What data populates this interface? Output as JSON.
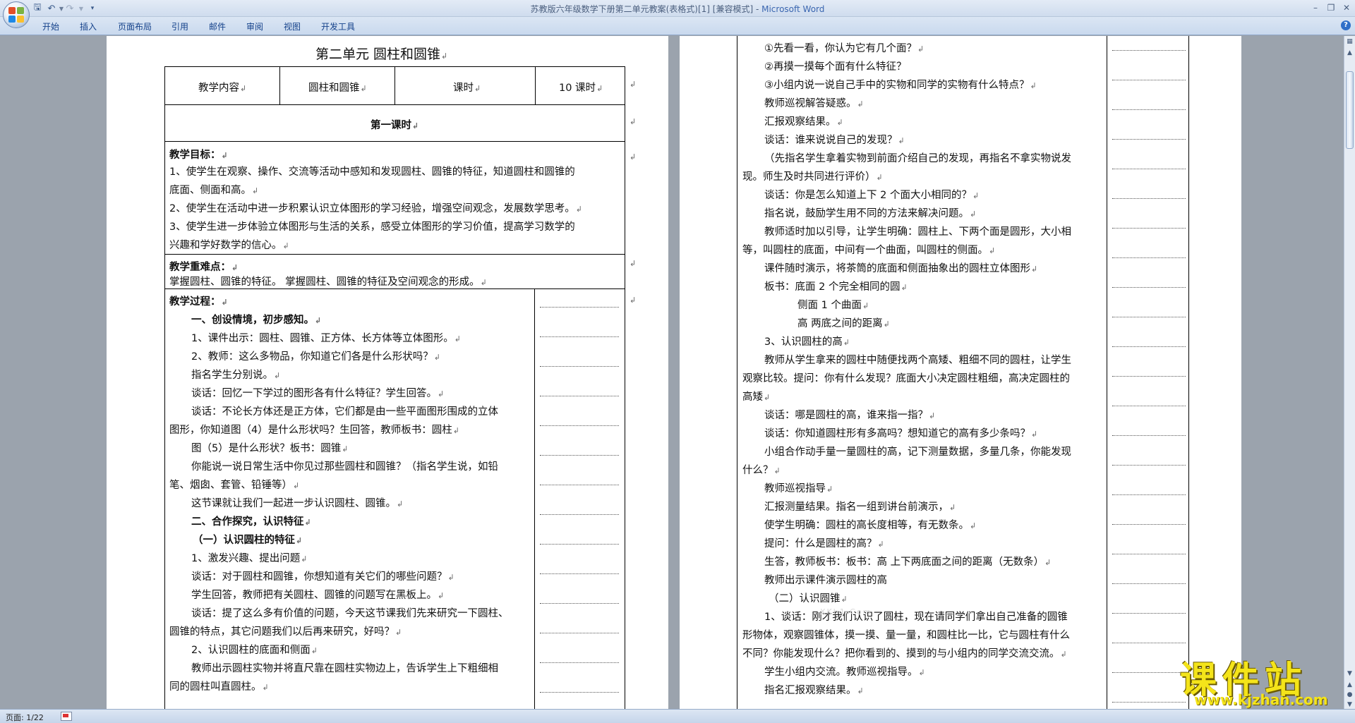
{
  "title_bar": {
    "doc_title": "苏教版六年级数学下册第二单元教案(表格式)[1] [兼容模式]",
    "separator": " - ",
    "app_name": "Microsoft Word",
    "qat_icons": [
      "save-icon",
      "undo-icon",
      "redo-icon",
      "customize-icon"
    ],
    "window_buttons": [
      "minimize",
      "restore",
      "close"
    ]
  },
  "ribbon": {
    "tabs": [
      "开始",
      "插入",
      "页面布局",
      "引用",
      "邮件",
      "审阅",
      "视图",
      "开发工具"
    ]
  },
  "page1": {
    "heading": "第二单元    圆柱和圆锥",
    "row1": [
      "教学内容",
      "圆柱和圆锥",
      "课时",
      "10 课时"
    ],
    "lesson": "第一课时",
    "goals": [
      "教学目标：",
      "1、使学生在观察、操作、交流等活动中感知和发现圆柱、圆锥的特征，知道圆柱和圆锥的",
      "底面、侧面和高。",
      "2、使学生在活动中进一步积累认识立体图形的学习经验，增强空间观念，发展数学思考。",
      "3、使学生进一步体验立体图形与生活的关系，感受立体图形的学习价值，提高学习数学的",
      "兴趣和学好数学的信心。"
    ],
    "key_points": [
      "教学重难点：",
      "掌握圆柱、圆锥的特征。   掌握圆柱、圆锥的特征及空间观念的形成。"
    ],
    "process": [
      "教学过程：",
      "一、创设情境，初步感知。",
      "1、课件出示：圆柱、圆锥、正方体、长方体等立体图形。",
      "2、教师：这么多物品，你知道它们各是什么形状吗？",
      "指名学生分别说。",
      "谈话：回忆一下学过的图形各有什么特征？学生回答。",
      "谈话：不论长方体还是正方体，它们都是由一些平面图形围成的立体",
      "图形，你知道图（4）是什么形状吗？生回答，教师板书：圆柱",
      "图（5）是什么形状？板书：圆锥",
      "你能说一说日常生活中你见过那些圆柱和圆锥？（指名学生说，如铅",
      "笔、烟囱、套管、铅锤等）",
      "这节课就让我们一起进一步认识圆柱、圆锥。",
      "二、合作探究，认识特征",
      "（一）认识圆柱的特征",
      "1、激发兴趣、提出问题",
      "谈话：对于圆柱和圆锥，你想知道有关它们的哪些问题？",
      "学生回答，教师把有关圆柱、圆锥的问题写在黑板上。",
      "谈话：提了这么多有价值的问题，今天这节课我们先来研究一下圆柱、",
      "圆锥的特点，其它问题我们以后再来研究，好吗？",
      "2、认识圆柱的底面和侧面",
      "教师出示圆柱实物并将直尺靠在圆柱实物边上，告诉学生上下粗细相",
      "同的圆柱叫直圆柱。"
    ]
  },
  "page2": {
    "lines": [
      "①先看一看，你认为它有几个面？",
      "②再摸一摸每个面有什么特征？",
      "③小组内说一说自己手中的实物和同学的实物有什么特点？",
      "教师巡视解答疑惑。",
      "汇报观察结果。",
      "谈话：谁来说说自己的发现？",
      "（先指名学生拿着实物到前面介绍自己的发现，再指名不拿实物说发",
      "现。师生及时共同进行评价）",
      "谈话：你是怎么知道上下 2 个面大小相同的？",
      "指名说，鼓励学生用不同的方法来解决问题。",
      "教师适时加以引导，让学生明确：圆柱上、下两个面是圆形，大小相",
      "等，叫圆柱的底面，中间有一个曲面，叫圆柱的侧面。",
      "课件随时演示，将茶筒的底面和侧面抽象出的圆柱立体图形",
      "板书：底面       2 个完全相同的圆",
      "侧面      1 个曲面",
      "高      两底之间的距离",
      "3、认识圆柱的高",
      "教师从学生拿来的圆柱中随便找两个高矮、粗细不同的圆柱，让学生",
      "观察比较。提问：你有什么发现？底面大小决定圆柱粗细，高决定圆柱的",
      "高矮",
      "谈话：哪是圆柱的高，谁来指一指？",
      "谈话：你知道圆柱形有多高吗？想知道它的高有多少条吗？",
      "小组合作动手量一量圆柱的高，记下测量数据，多量几条，你能发现",
      "什么？",
      "教师巡视指导",
      "汇报测量结果。指名一组到讲台前演示，",
      "使学生明确：圆柱的高长度相等，有无数条。",
      "提问：什么是圆柱的高？",
      "生答，教师板书：板书：高   上下两底面之间的距离（无数条）",
      "教师出示课件演示圆柱的高",
      "（二）认识圆锥",
      "1、谈话：刚才我们认识了圆柱，现在请同学们拿出自己准备的圆锥",
      "形物体，观察圆锥体，摸一摸、量一量，和圆柱比一比，它与圆柱有什么",
      "不同？你能发现什么？把你看到的、摸到的与小组内的同学交流交流。",
      "学生小组内交流。教师巡视指导。",
      "指名汇报观察结果。"
    ],
    "faint_mark": "XKb1.Com"
  },
  "status_bar": {
    "page_info": "页面: 1/22"
  },
  "watermark": {
    "cn": "课件站",
    "url": "www.kjzhan.com"
  }
}
